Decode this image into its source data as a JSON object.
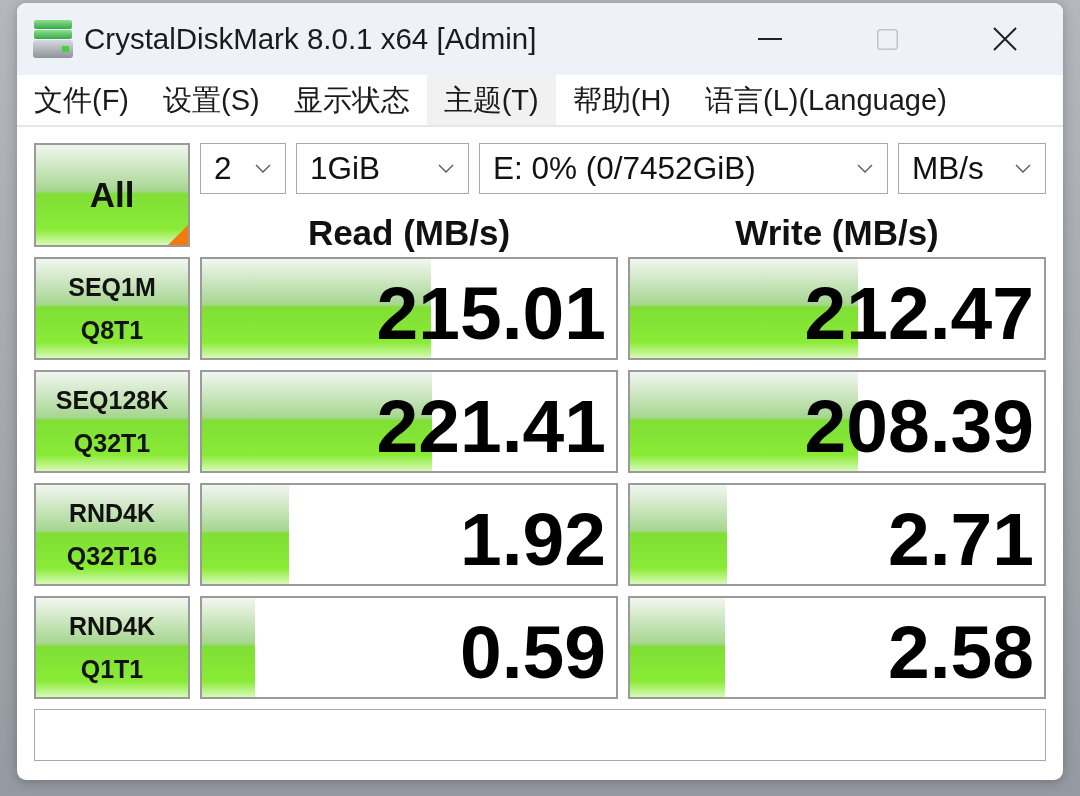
{
  "window": {
    "title": "CrystalDiskMark 8.0.1 x64 [Admin]",
    "maximize_disabled": true
  },
  "menu": [
    {
      "label": "文件(F)",
      "selected": false
    },
    {
      "label": "设置(S)",
      "selected": false
    },
    {
      "label": "显示状态",
      "selected": false
    },
    {
      "label": "主题(T)",
      "selected": true
    },
    {
      "label": "帮助(H)",
      "selected": false
    },
    {
      "label": "语言(L)(Language)",
      "selected": false
    }
  ],
  "toolbar": {
    "all_button": "All",
    "count": "2",
    "size": "1GiB",
    "drive": "E: 0% (0/7452GiB)",
    "unit": "MB/s"
  },
  "columns": [
    "Read (MB/s)",
    "Write (MB/s)"
  ],
  "tests": [
    {
      "name": "SEQ1M",
      "params": "Q8T1",
      "read": {
        "value": "215.01",
        "level": 0.553
      },
      "write": {
        "value": "212.47",
        "level": 0.55
      }
    },
    {
      "name": "SEQ128K",
      "params": "Q32T1",
      "read": {
        "value": "221.41",
        "level": 0.555
      },
      "write": {
        "value": "208.39",
        "level": 0.55
      }
    },
    {
      "name": "RND4K",
      "params": "Q32T16",
      "read": {
        "value": "1.92",
        "level": 0.21
      },
      "write": {
        "value": "2.71",
        "level": 0.234
      }
    },
    {
      "name": "RND4K",
      "params": "Q1T1",
      "read": {
        "value": "0.59",
        "level": 0.127
      },
      "write": {
        "value": "2.58",
        "level": 0.23
      }
    }
  ]
}
